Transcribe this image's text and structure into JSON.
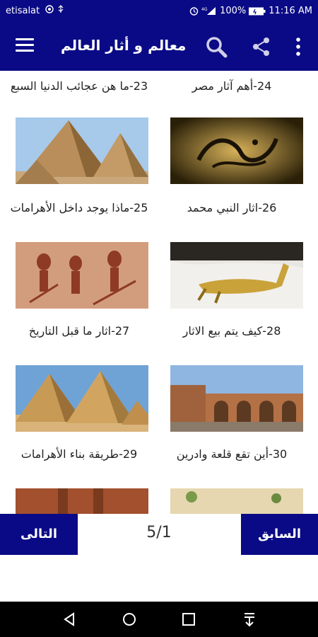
{
  "status": {
    "carrier": "etisalat",
    "battery": "100%",
    "time": "11:16 AM"
  },
  "appbar": {
    "title": "معالم و أثار العالم"
  },
  "items": [
    {
      "caption": "24-أهم آثار مصر"
    },
    {
      "caption": "23-ما هن عجائب الدنيا السبع"
    },
    {
      "caption": "26-اثار النبي محمد"
    },
    {
      "caption": "25-ماذا يوجد داخل الأهرامات"
    },
    {
      "caption": "28-كيف يتم بيع الاثار"
    },
    {
      "caption": "27-اثار ما قبل التاريخ"
    },
    {
      "caption": "30-أين تقع قلعة وادرين"
    },
    {
      "caption": "29-طريقة بناء الأهرامات"
    }
  ],
  "pagination": {
    "prev_label": "السابق",
    "next_label": "التالى",
    "page_indicator": "5/1"
  },
  "colors": {
    "primary": "#0a0a86"
  }
}
